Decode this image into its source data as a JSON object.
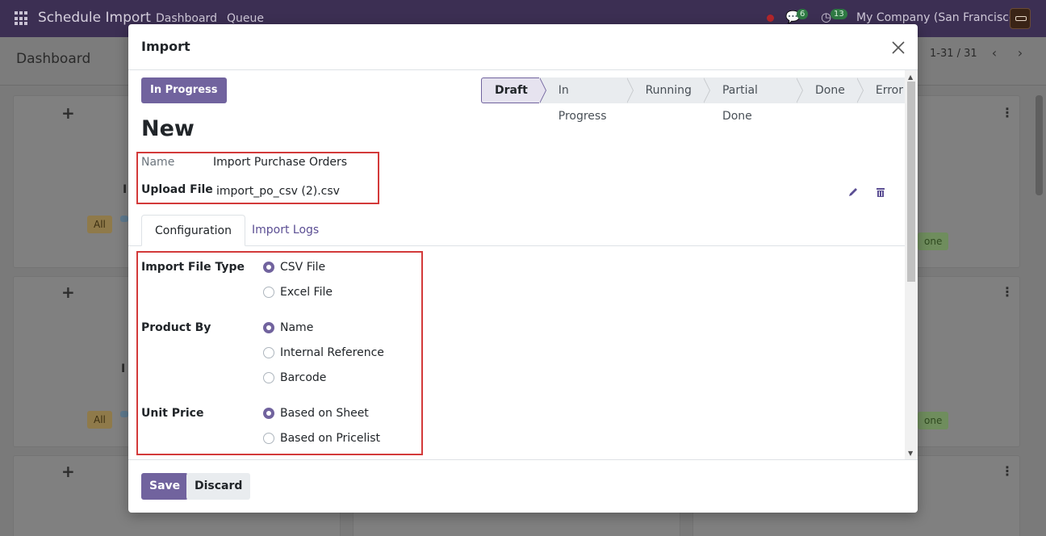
{
  "app": {
    "brand": "Schedule Import",
    "nav": [
      "Dashboard",
      "Queue"
    ],
    "messages_count": "6",
    "activities_count": "13",
    "company": "My Company (San Francisco)"
  },
  "control_panel": {
    "title": "Dashboard",
    "pager": "1-31 / 31"
  },
  "background_cards": {
    "tag_all": "All",
    "tag_done": "one"
  },
  "modal": {
    "title": "Import",
    "status_button": "In Progress",
    "stages": [
      "Draft",
      "In Progress",
      "Running",
      "Partial Done",
      "Done",
      "Error"
    ],
    "active_stage": "Draft",
    "record_title": "New",
    "fields": {
      "name_label": "Name",
      "name_value": "Import Purchase Orders",
      "upload_label": "Upload File",
      "upload_value": "import_po_csv (2).csv"
    },
    "tabs": [
      "Configuration",
      "Import Logs"
    ],
    "config": {
      "file_type_label": "Import File Type",
      "file_type_options": [
        "CSV File",
        "Excel File"
      ],
      "file_type_selected": "CSV File",
      "product_by_label": "Product By",
      "product_by_options": [
        "Name",
        "Internal Reference",
        "Barcode"
      ],
      "product_by_selected": "Name",
      "unit_price_label": "Unit Price",
      "unit_price_options": [
        "Based on Sheet",
        "Based on Pricelist"
      ],
      "unit_price_selected": "Based on Sheet"
    },
    "footer": {
      "save": "Save",
      "discard": "Discard"
    }
  },
  "colors": {
    "primary": "#71639e",
    "highlight_border": "#d33a3a",
    "topbar": "#3c2f53"
  }
}
